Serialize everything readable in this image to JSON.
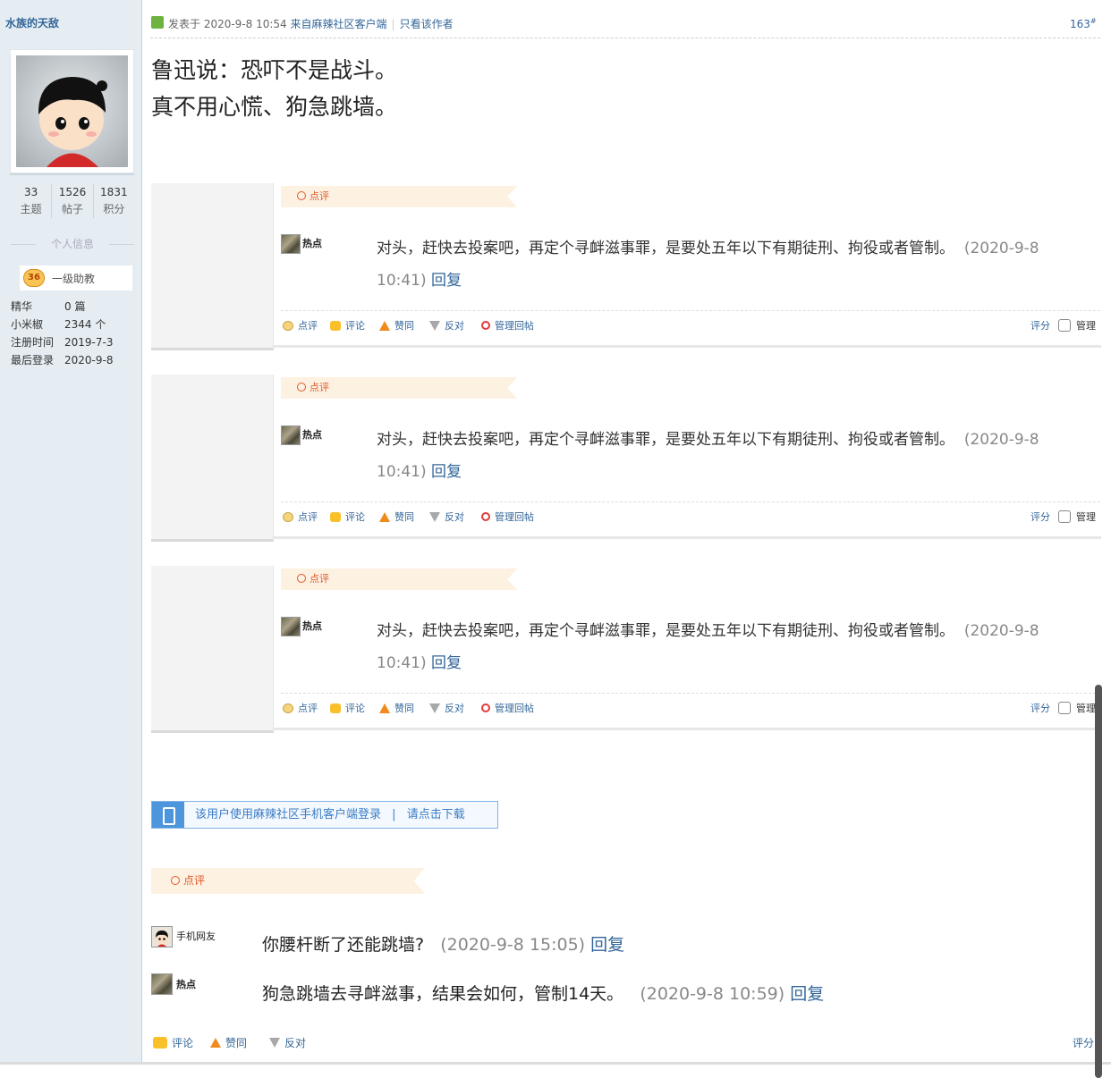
{
  "user": {
    "name": "水族的天敌",
    "stats": [
      {
        "value": "33",
        "label": "主题"
      },
      {
        "value": "1526",
        "label": "帖子"
      },
      {
        "value": "1831",
        "label": "积分"
      }
    ],
    "personal_info_title": "个人信息",
    "rank_level": "36",
    "rank_name": "一级助教",
    "info": [
      {
        "key": "精华",
        "value": "0 篇"
      },
      {
        "key": "小米椒",
        "value": "2344 个"
      },
      {
        "key": "注册时间",
        "value": "2019-7-3"
      },
      {
        "key": "最后登录",
        "value": "2020-9-8"
      }
    ]
  },
  "post": {
    "posted_prefix": "发表于 2020-9-8 10:54",
    "source": "来自麻辣社区客户端",
    "only_author": "只看该作者",
    "floor": "163",
    "floor_sup": "#",
    "content_line1": "鲁迅说：恐吓不是战斗。",
    "content_line2": "真不用心慌、狗急跳墙。"
  },
  "review_label": "点评",
  "comment_blocks": [
    {
      "user": "热点",
      "text": "对头，赶快去投案吧，再定个寻衅滋事罪，是要处五年以下有期徒刑、拘役或者管制。",
      "date_a": "(2020-9-8",
      "date_b": "10:41)",
      "reply": "回复"
    },
    {
      "user": "热点",
      "text": "对头，赶快去投案吧，再定个寻衅滋事罪，是要处五年以下有期徒刑、拘役或者管制。",
      "date_a": "(2020-9-8",
      "date_b": "10:41)",
      "reply": "回复"
    },
    {
      "user": "热点",
      "text": "对头，赶快去投案吧，再定个寻衅滋事罪，是要处五年以下有期徒刑、拘役或者管制。",
      "date_a": "(2020-9-8",
      "date_b": "10:41)",
      "reply": "回复"
    }
  ],
  "actions": {
    "review": "点评",
    "comment": "评论",
    "like": "赞同",
    "oppose": "反对",
    "manage_reply": "管理回帖",
    "rate": "评分",
    "manage": "管理"
  },
  "mobile_bar": {
    "text": "该用户使用麻辣社区手机客户端登录",
    "sep": "|",
    "link": "请点击下载"
  },
  "bottom_comments": [
    {
      "user": "手机网友",
      "text": "你腰杆断了还能跳墙?",
      "date": "(2020-9-8 15:05)",
      "reply": "回复"
    },
    {
      "user": "热点",
      "text": "狗急跳墙去寻衅滋事，结果会如何，管制14天。",
      "date": "(2020-9-8 10:59)",
      "reply": "回复"
    }
  ]
}
